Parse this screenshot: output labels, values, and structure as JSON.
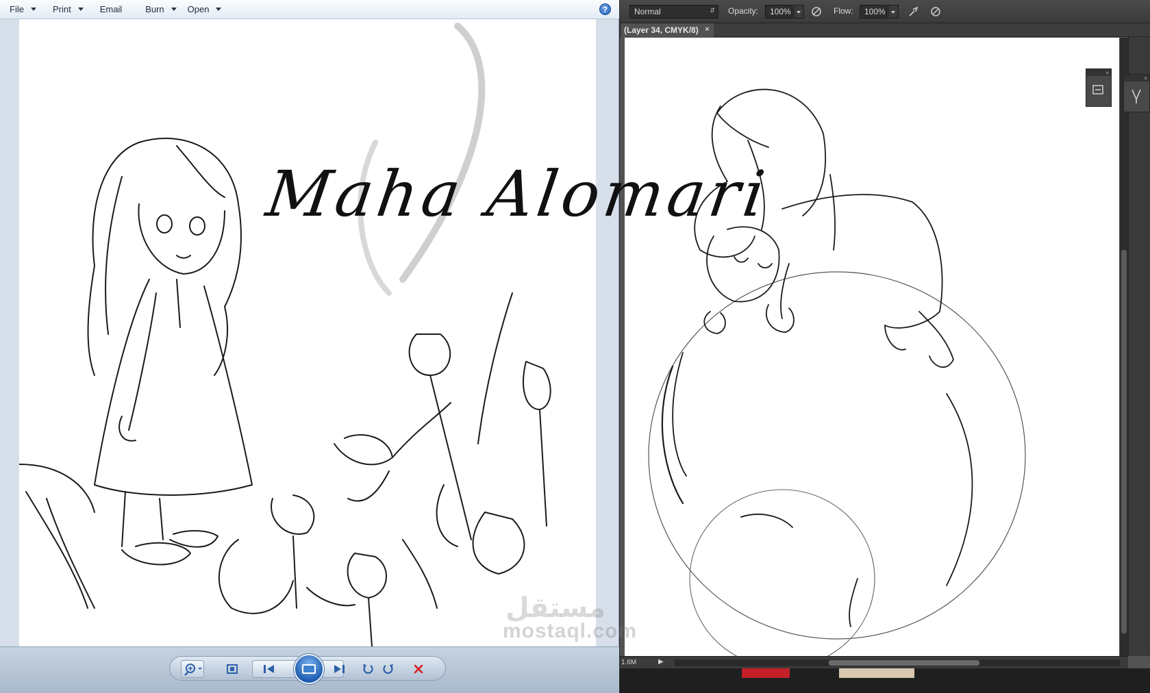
{
  "viewer": {
    "menu": [
      {
        "label": "File",
        "has_dropdown": true
      },
      {
        "label": "Print",
        "has_dropdown": true
      },
      {
        "label": "Email",
        "has_dropdown": false
      },
      {
        "label": "Burn",
        "has_dropdown": true
      },
      {
        "label": "Open",
        "has_dropdown": true
      }
    ],
    "help_label": "?",
    "toolbar": {
      "icons": [
        "zoom-icon",
        "actual-size-icon",
        "previous-icon",
        "slideshow-icon",
        "next-icon",
        "rotate-left-icon",
        "rotate-right-icon",
        "delete-icon"
      ]
    }
  },
  "photoshop": {
    "options": {
      "blend_mode": "Normal",
      "opacity_label": "Opacity:",
      "opacity_value": "100%",
      "flow_label": "Flow:",
      "flow_value": "100%"
    },
    "tab": {
      "title": "(Layer 34, CMYK/8)",
      "close": "×"
    },
    "status": {
      "doc_size": "1.6M"
    }
  },
  "overlay": {
    "signature": "Maha Alomari",
    "watermark": "mostaql.com",
    "watermark_ar": "مستقل"
  },
  "colors": {
    "viewer_chrome": "#d7e0ea",
    "ps_background": "#535353",
    "ps_toolbar": "#3b3b3b",
    "delete_red": "#d32020",
    "accent_blue": "#1f5fb8"
  }
}
